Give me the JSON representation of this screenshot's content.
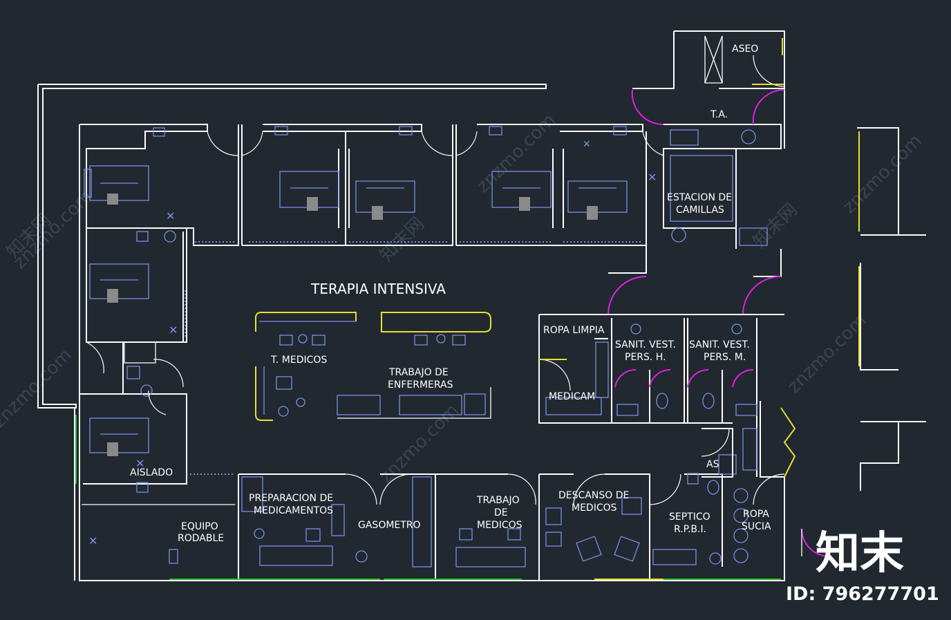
{
  "plan": {
    "title": "TERAPIA INTENSIVA",
    "rooms": {
      "aseo": "ASEO",
      "ta": "T.A.",
      "estacion_1": "ESTACION DE",
      "estacion_2": "CAMILLAS",
      "t_medicos": "T. MEDICOS",
      "trabajo_enf_1": "TRABAJO DE",
      "trabajo_enf_2": "ENFERMERAS",
      "ropa_limpia": "ROPA LIMPIA",
      "sanit_h_1": "SANIT. VEST.",
      "sanit_h_2": "PERS. H.",
      "sanit_m_1": "SANIT. VEST.",
      "sanit_m_2": "PERS. M.",
      "medicam": "MEDICAM",
      "aislado": "AISLADO",
      "equipo_1": "EQUIPO",
      "equipo_2": "RODABLE",
      "prep_1": "PREPARACION DE",
      "prep_2": "MEDICAMENTOS",
      "gasometro": "GASOMETRO",
      "trabajo_med_1": "TRABAJO",
      "trabajo_med_2": "DE",
      "trabajo_med_3": "MEDICOS",
      "descanso_1": "DESCANSO DE",
      "descanso_2": "MEDICOS",
      "septico_1": "SEPTICO",
      "septico_2": "R.P.B.I.",
      "ropa_sucia_1": "ROPA",
      "ropa_sucia_2": "SUCIA",
      "as": "AS"
    }
  },
  "watermark": {
    "site": "znzmo.com",
    "cn": "知末网",
    "brand": "知末",
    "id": "ID: 796277701"
  },
  "colors": {
    "background": "#212830",
    "walls": "#ffffff",
    "furniture": "#7d8ee8",
    "doors_highlight": "#e020e0",
    "windows": "#e8e030",
    "glazing": "#20c020"
  }
}
